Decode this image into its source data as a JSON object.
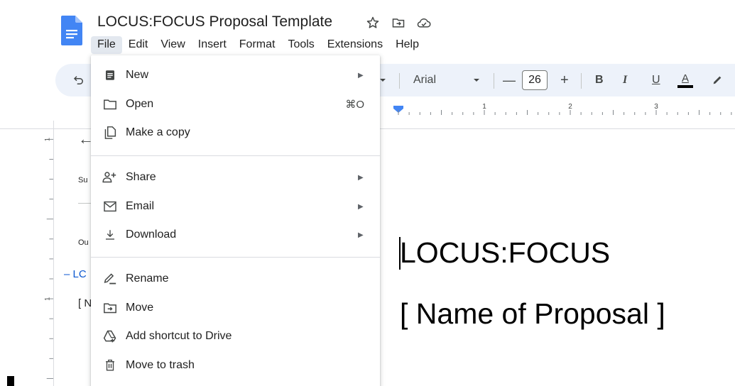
{
  "document": {
    "title": "LOCUS:FOCUS Proposal Template",
    "body_line1": "LOCUS:FOCUS",
    "body_line2": "[ Name of Proposal ]"
  },
  "menubar": [
    "File",
    "Edit",
    "View",
    "Insert",
    "Format",
    "Tools",
    "Extensions",
    "Help"
  ],
  "toolbar": {
    "font": "Arial",
    "font_size": "26",
    "minus": "—",
    "plus": "+",
    "bold": "B",
    "italic": "I",
    "underline": "U",
    "text_color": "A"
  },
  "ruler": {
    "labels": [
      "1",
      "2",
      "3"
    ]
  },
  "vruler": {
    "labels": [
      "1",
      "1"
    ]
  },
  "sidebar": {
    "heading1": "Su",
    "heading2": "Ou",
    "active_item": "– LC",
    "item": "[ N"
  },
  "file_menu": {
    "items": [
      {
        "label": "New",
        "icon": "document-icon",
        "submenu": true
      },
      {
        "label": "Open",
        "icon": "folder-icon",
        "shortcut": "⌘O"
      },
      {
        "label": "Make a copy",
        "icon": "copy-icon"
      },
      {
        "label": "Share",
        "icon": "share-person-icon",
        "submenu": true
      },
      {
        "label": "Email",
        "icon": "email-icon",
        "submenu": true
      },
      {
        "label": "Download",
        "icon": "download-icon",
        "submenu": true
      },
      {
        "label": "Rename",
        "icon": "rename-icon"
      },
      {
        "label": "Move",
        "icon": "move-folder-icon"
      },
      {
        "label": "Add shortcut to Drive",
        "icon": "drive-shortcut-icon"
      },
      {
        "label": "Move to trash",
        "icon": "trash-icon"
      }
    ]
  },
  "colors": {
    "accent_blue": "#0b57d0",
    "docs_logo_blue": "#4285f4",
    "toolbar_bg": "#edf2fa",
    "menu_active_bg": "#e3e8ef"
  }
}
